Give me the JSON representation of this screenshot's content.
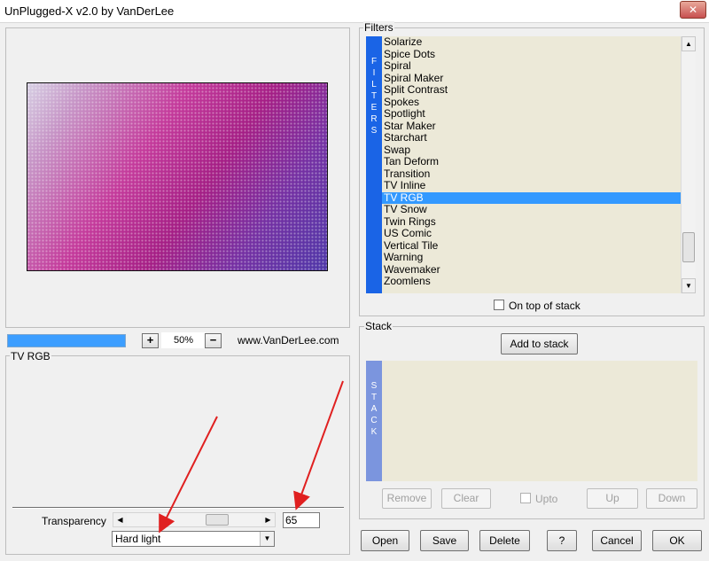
{
  "window": {
    "title": "UnPlugged-X v2.0 by VanDerLee",
    "close_label": "✕"
  },
  "preview": {
    "zoom_in_label": "+",
    "zoom_value": "50%",
    "zoom_out_label": "−",
    "website": "www.VanDerLee.com"
  },
  "filters": {
    "group_label": "Filters",
    "strip_letters": [
      "F",
      "I",
      "L",
      "T",
      "E",
      "R",
      "S"
    ],
    "items": [
      "Solarize",
      "Spice Dots",
      "Spiral",
      "Spiral Maker",
      "Split Contrast",
      "Spokes",
      "Spotlight",
      "Star Maker",
      "Starchart",
      "Swap",
      "Tan Deform",
      "Transition",
      "TV Inline",
      "TV RGB",
      "TV Snow",
      "Twin Rings",
      "US Comic",
      "Vertical Tile",
      "Warning",
      "Wavemaker",
      "Zoomlens"
    ],
    "selected_index": 13,
    "on_top_label": "On top of stack"
  },
  "settings": {
    "group_label": "TV RGB",
    "transparency_label": "Transparency",
    "transparency_value": "65",
    "blend_mode": "Hard light"
  },
  "stack": {
    "group_label": "Stack",
    "add_label": "Add to stack",
    "strip_letters": [
      "S",
      "T",
      "A",
      "C",
      "K"
    ],
    "remove_label": "Remove",
    "clear_label": "Clear",
    "upto_label": "Upto",
    "up_label": "Up",
    "down_label": "Down"
  },
  "footer": {
    "open_label": "Open",
    "save_label": "Save",
    "delete_label": "Delete",
    "help_label": "?",
    "cancel_label": "Cancel",
    "ok_label": "OK"
  },
  "colors": {
    "selection": "#3399ff",
    "filters_strip": "#1a64e6",
    "stack_strip": "#7b95de",
    "annotation_arrow": "#e02020"
  }
}
